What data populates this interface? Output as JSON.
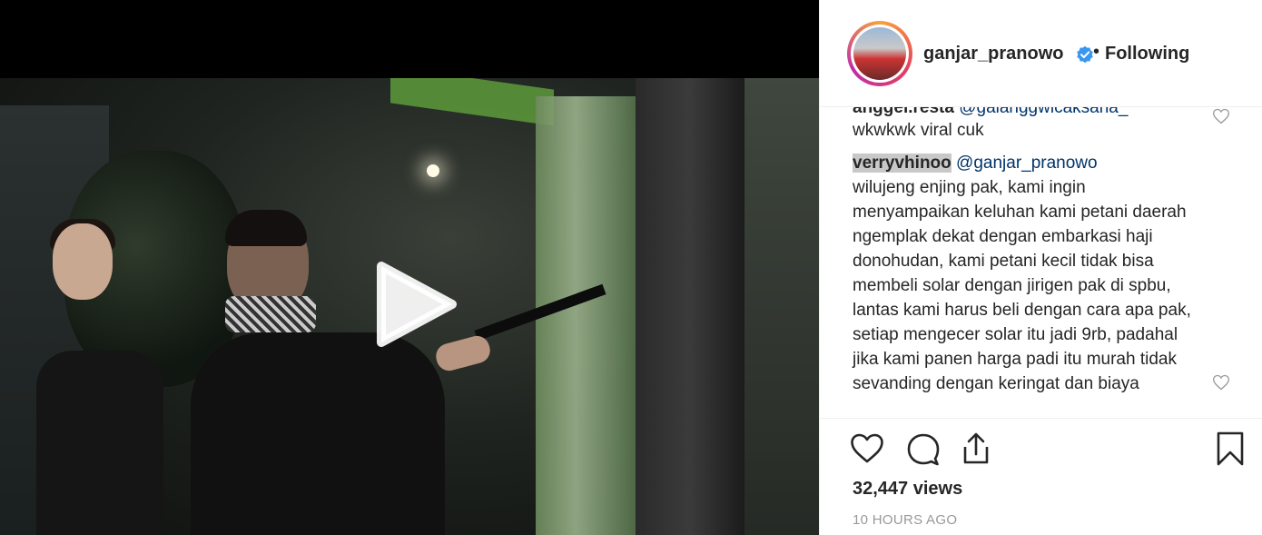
{
  "post": {
    "username": "ganjar_pranowo",
    "separator": "•",
    "follow_status": "Following",
    "views": "32,447 views",
    "time_ago": "10 HOURS AGO"
  },
  "comments": [
    {
      "username": "anggel.resta",
      "mention": "@galanggwicaksana_",
      "text": "wkwkwk viral cuk"
    },
    {
      "username": "verryvhinoo",
      "mention": "@ganjar_pranowo",
      "text": "wilujeng enjing pak, kami ingin menyampaikan keluhan kami petani daerah ngemplak dekat dengan embarkasi haji donohudan, kami petani kecil tidak bisa membeli solar dengan jirigen pak di spbu, lantas kami harus beli dengan cara apa pak, setiap mengecer solar itu jadi 9rb, padahal jika kami panen harga padi itu murah tidak sevanding dengan keringat dan biaya"
    }
  ],
  "icons": {
    "play": "play-icon",
    "verified": "verified-badge-icon",
    "like": "heart-icon",
    "comment": "comment-bubble-icon",
    "share": "share-icon",
    "save": "bookmark-icon"
  },
  "colors": {
    "mention": "#003569",
    "verified": "#3897f0",
    "muted": "#999999"
  }
}
